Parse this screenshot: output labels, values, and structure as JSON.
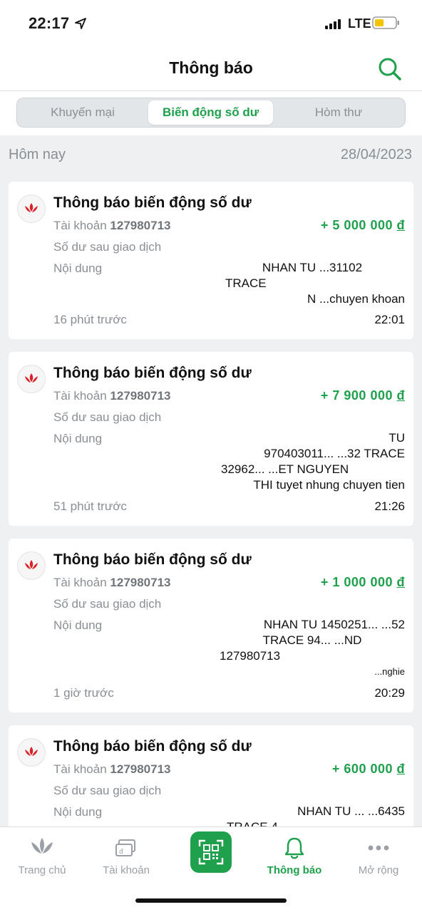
{
  "status_bar": {
    "time": "22:17",
    "network": "LTE"
  },
  "header": {
    "title": "Thông báo"
  },
  "tabs": [
    {
      "label": "Khuyến mại"
    },
    {
      "label": "Biến động số dư"
    },
    {
      "label": "Hòm thư"
    }
  ],
  "date_row": {
    "left": "Hôm nay",
    "right": "28/04/2023"
  },
  "labels": {
    "account": "Tài khoản",
    "balance_after": "Số dư sau giao dịch",
    "content": "Nội dung"
  },
  "cards": [
    {
      "title": "Thông báo biến động số dư",
      "account_number": "127980713",
      "amount": "+ 5 000 000",
      "currency": "đ",
      "balance_value": "",
      "content_lines": [
        "NHAN TU          ...31102",
        "TRACE",
        "N      ...chuyen khoan"
      ],
      "ago": "16 phút trước",
      "time": "22:01"
    },
    {
      "title": "Thông báo biến động số dư",
      "account_number": "127980713",
      "amount": "+ 7 900 000",
      "currency": "đ",
      "balance_value": "",
      "content_lines": [
        "TU",
        "970403011...   ...32 TRACE",
        "32962...   ...ET NGUYEN",
        "THI tuyet nhung chuyen tien"
      ],
      "ago": "51 phút trước",
      "time": "21:26"
    },
    {
      "title": "Thông báo biến động số dư",
      "account_number": "127980713",
      "amount": "+ 1 000 000",
      "currency": "đ",
      "balance_value": "",
      "content_lines": [
        "NHAN TU 1450251...   ...52",
        "TRACE 94...   ...ND",
        "127980713",
        "...nghie"
      ],
      "ago": "1 giờ trước",
      "time": "20:29"
    },
    {
      "title": "Thông báo biến động số dư",
      "account_number": "127980713",
      "amount": "+ 600 000",
      "currency": "đ",
      "balance_value": "",
      "content_lines": [
        "NHAN TU ...   ...6435",
        "TRACE 4"
      ],
      "ago": "",
      "time": ""
    }
  ],
  "bottom_nav": [
    {
      "label": "Trang chủ",
      "icon": "lotus-icon"
    },
    {
      "label": "Tài khoản",
      "icon": "card-icon"
    },
    {
      "label": "",
      "icon": "qr-scan-icon"
    },
    {
      "label": "Thông báo",
      "icon": "bell-icon"
    },
    {
      "label": "Mở rộng",
      "icon": "more-dots-icon"
    }
  ],
  "colors": {
    "accent": "#1fa04c",
    "brand_red": "#d8232a",
    "background": "#eef0f2"
  }
}
